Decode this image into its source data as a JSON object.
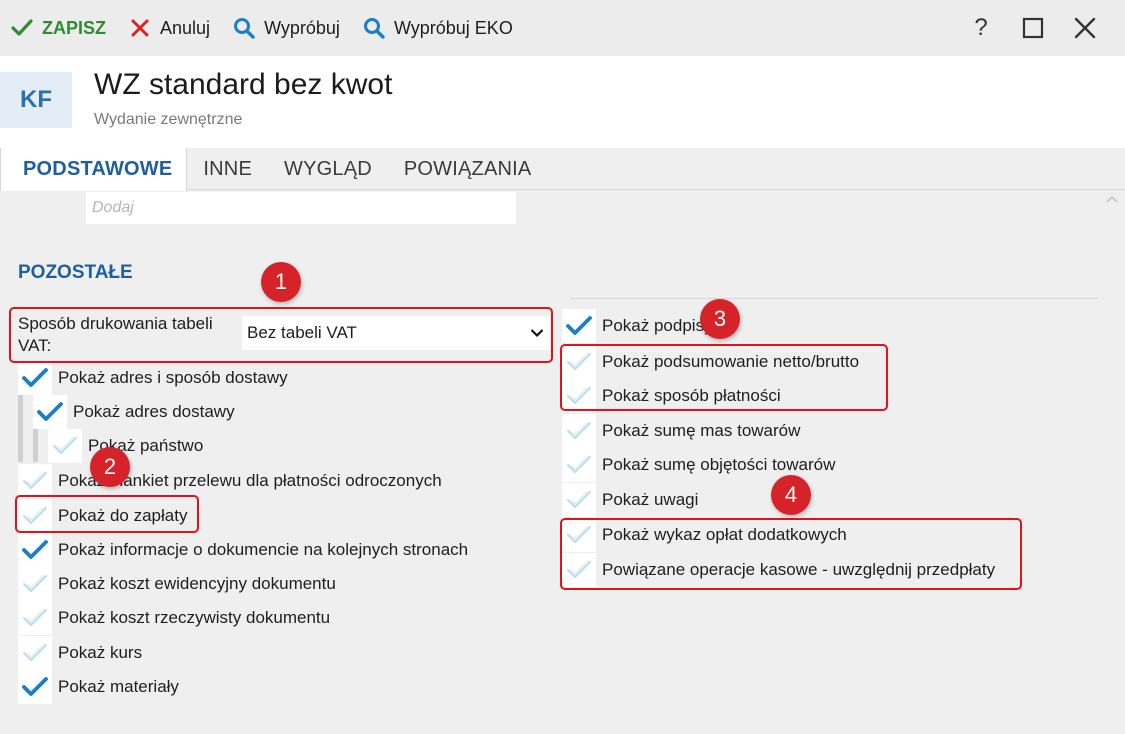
{
  "toolbar": {
    "save_label": "ZAPISZ",
    "cancel_label": "Anuluj",
    "try_label": "Wypróbuj",
    "try_eco_label": "Wypróbuj EKO",
    "help_label": "?"
  },
  "header": {
    "badge": "KF",
    "title": "WZ standard bez kwot",
    "subtitle": "Wydanie zewnętrzne"
  },
  "tabs": [
    {
      "label": "PODSTAWOWE",
      "active": true
    },
    {
      "label": "INNE",
      "active": false
    },
    {
      "label": "WYGLĄD",
      "active": false
    },
    {
      "label": "POWIĄZANIA",
      "active": false
    }
  ],
  "add_field": {
    "placeholder": "Dodaj",
    "value": ""
  },
  "section": {
    "title": "POZOSTAŁE",
    "vat_select": {
      "label": "Sposób drukowania tabeli VAT:",
      "value": "Bez tabeli VAT"
    },
    "left_options": [
      {
        "label": "Pokaż adres i sposób dostawy",
        "checked": true
      },
      {
        "label": "Pokaż adres dostawy",
        "checked": true
      },
      {
        "label": "Pokaż państwo",
        "checked": false
      },
      {
        "label": "Pokaż blankiet przelewu dla płatności odroczonych",
        "checked": false
      },
      {
        "label": "Pokaż do zapłaty",
        "checked": false
      },
      {
        "label": "Pokaż informacje o dokumencie na kolejnych stronach",
        "checked": true
      },
      {
        "label": "Pokaż koszt ewidencyjny dokumentu",
        "checked": false
      },
      {
        "label": "Pokaż koszt rzeczywisty dokumentu",
        "checked": false
      },
      {
        "label": "Pokaż kurs",
        "checked": false
      },
      {
        "label": "Pokaż materiały",
        "checked": true
      }
    ],
    "right_options": [
      {
        "label": "Pokaż podpisy",
        "checked": true
      },
      {
        "label": "Pokaż podsumowanie netto/brutto",
        "checked": false
      },
      {
        "label": "Pokaż sposób płatności",
        "checked": false
      },
      {
        "label": "Pokaż sumę mas towarów",
        "checked": false
      },
      {
        "label": "Pokaż sumę objętości towarów",
        "checked": false
      },
      {
        "label": "Pokaż uwagi",
        "checked": false
      },
      {
        "label": "Pokaż wykaz opłat dodatkowych",
        "checked": false
      },
      {
        "label": "Powiązane operacje kasowe - uwzględnij przedpłaty",
        "checked": false
      }
    ]
  },
  "annotations": {
    "m1": "1",
    "m2": "2",
    "m3": "3",
    "m4": "4"
  },
  "colors": {
    "accent": "#1f5f9e",
    "check_on": "#1a7fc9",
    "check_off": "#b9dcef",
    "annotation": "#e0131a",
    "save": "#2e8b2e"
  },
  "icons": {
    "save": "check-icon",
    "cancel": "x-icon",
    "try": "search-icon",
    "checkbox_on": "check-icon",
    "checkbox_off": "check-faint-icon"
  }
}
